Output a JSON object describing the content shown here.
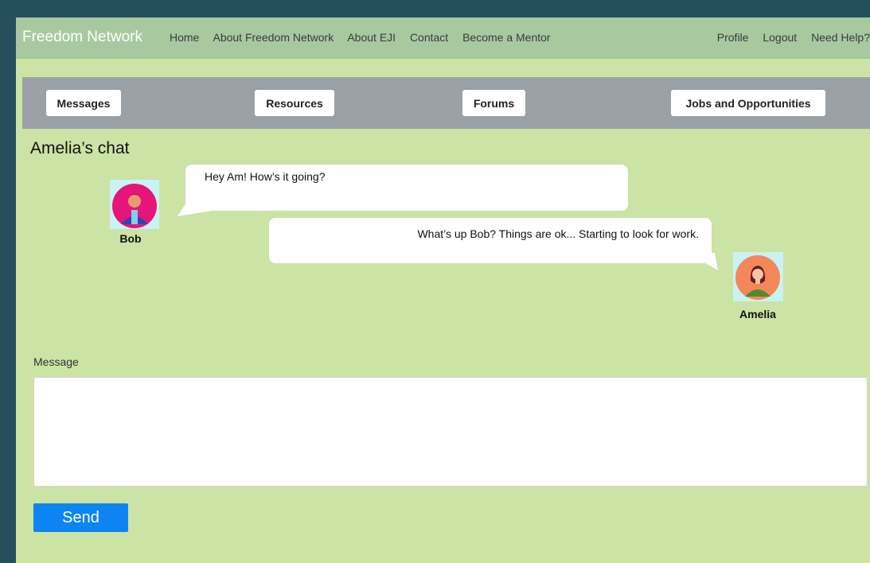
{
  "nav": {
    "brand": "Freedom Network",
    "links": [
      "Home",
      "About Freedom Network",
      "About EJI",
      "Contact",
      "Become a Mentor"
    ],
    "right_links": [
      "Profile",
      "Logout",
      "Need Help?"
    ]
  },
  "tabs": [
    "Messages",
    "Resources",
    "Forums",
    "Jobs and Opportunities"
  ],
  "chat": {
    "title": "Amelia’s chat",
    "messages": [
      {
        "sender": "Bob",
        "text": "Hey Am! How’s it going?"
      },
      {
        "sender": "Amelia",
        "text": "What’s up Bob? Things are ok... Starting to look for work."
      }
    ]
  },
  "composer": {
    "label": "Message",
    "value": "",
    "placeholder": "",
    "send_label": "Send"
  },
  "colors": {
    "page_bg": "#254f5b",
    "content_bg": "#cbe3a5",
    "topnav_bg": "#a8c9a0",
    "tabbar_bg": "#9aa1a6",
    "send_button": "#0d84f2"
  },
  "icons": {
    "bob_avatar": "user-avatar-icon",
    "amelia_avatar": "user-avatar-icon"
  }
}
